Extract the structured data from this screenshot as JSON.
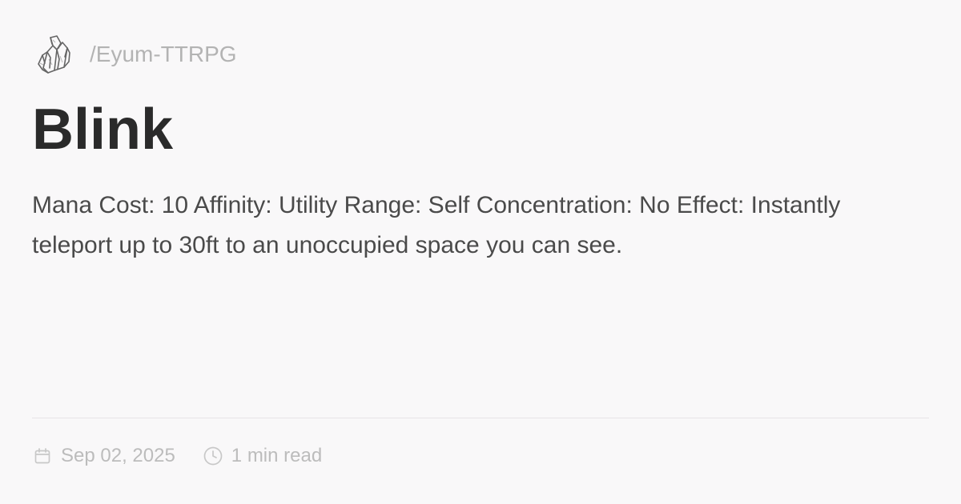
{
  "site": {
    "logo_icon": "crystal-cluster-icon",
    "name": "/Eyum-TTRPG"
  },
  "post": {
    "title": "Blink",
    "description": "Mana Cost: 10 Affinity: Utility Range: Self Concentration: No Effect: Instantly teleport up to 30ft to an unoccupied space you can see."
  },
  "meta": {
    "date_icon": "calendar-icon",
    "date": "Sep 02, 2025",
    "read_icon": "clock-icon",
    "read_time": "1 min read"
  },
  "colors": {
    "background": "#f9f8f9",
    "title": "#2a2a2a",
    "body_text": "#4a4a4a",
    "muted_text": "#bcbcbc",
    "divider": "#e7e4e7"
  }
}
